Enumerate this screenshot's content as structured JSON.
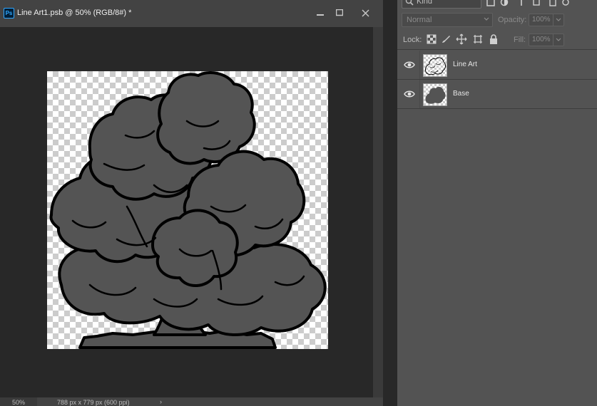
{
  "document": {
    "title": "Line Art1.psb @ 50% (RGB/8#) *",
    "app_icon": "ps-icon",
    "app_icon_text": "Ps",
    "controls": [
      "minimize-icon",
      "maximize-icon",
      "close-icon"
    ]
  },
  "status": {
    "zoom": "50%",
    "info": "788 px x 779 px (600 ppi)",
    "arrow": "›"
  },
  "layers_panel": {
    "filter": {
      "selected": "Kind",
      "icon": "search-icon"
    },
    "blend_mode": "Normal",
    "opacity_label": "Opacity:",
    "opacity_value": "100%",
    "lock_label": "Lock:",
    "fill_label": "Fill:",
    "fill_value": "100%",
    "layers": [
      {
        "name": "Line Art",
        "visible": true
      },
      {
        "name": "Base",
        "visible": true
      }
    ]
  },
  "colors": {
    "accent": "#31a8ff",
    "panel_bg": "#535353",
    "canvas_bg": "#282828",
    "tree_fill": "#545454",
    "tree_line": "#000000"
  }
}
